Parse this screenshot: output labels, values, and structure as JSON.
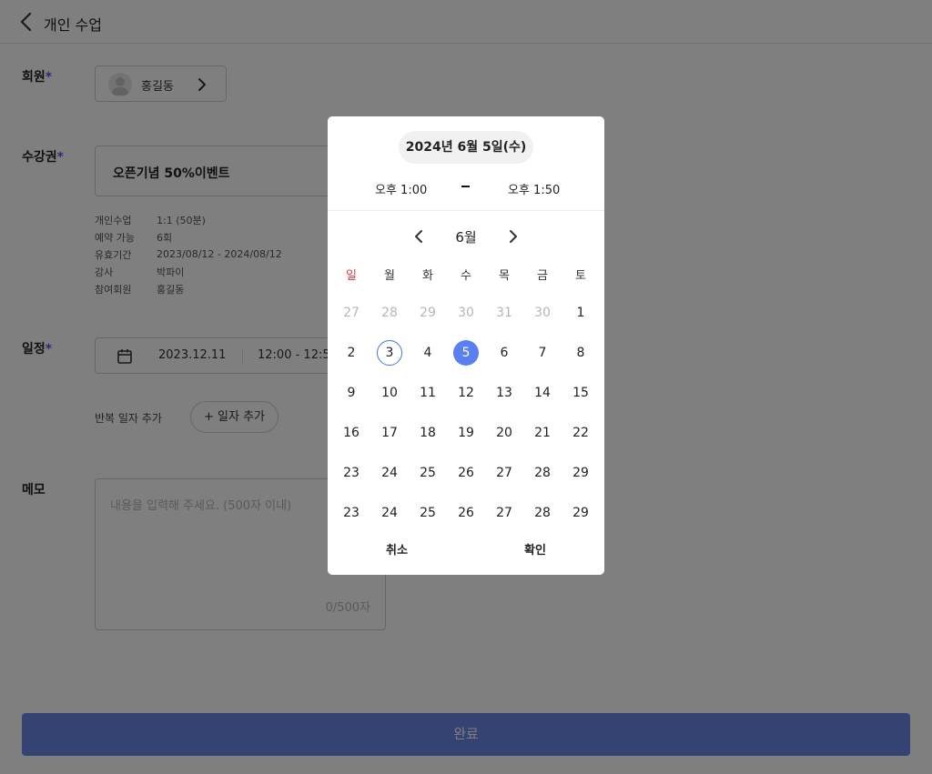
{
  "header": {
    "title": "개인 수업"
  },
  "member": {
    "label": "회원",
    "required_mark": "*",
    "name": "홍길동"
  },
  "pass": {
    "label": "수강권",
    "required_mark": "*",
    "name": "오픈기념 50%이벤트",
    "details": [
      {
        "key": "개인수업",
        "value": "1:1 (50분)"
      },
      {
        "key": "예약 가능",
        "value": "6회"
      },
      {
        "key": "유효기간",
        "value": "2023/08/12 - 2024/08/12"
      },
      {
        "key": "강사",
        "value": "박파이"
      },
      {
        "key": "참여회원",
        "value": "홍길동"
      }
    ]
  },
  "schedule": {
    "label": "일정",
    "required_mark": "*",
    "date": "2023.12.11",
    "time": "12:00 - 12:50",
    "repeat_label": "반복 일자 추가",
    "add_day_button": "+ 일자 추가"
  },
  "memo": {
    "label": "메모",
    "placeholder": "내용을 입력해 주세요. (500자 이내)",
    "counter": "0/500자"
  },
  "done_button": "완료",
  "picker": {
    "selected_date": "2024년  6월 5일(수)",
    "start_time": "오후 1:00",
    "end_time": "오후 1:50",
    "month": "6월",
    "weekdays": [
      "일",
      "월",
      "화",
      "수",
      "목",
      "금",
      "토"
    ],
    "weeks": [
      [
        "27",
        "28",
        "29",
        "30",
        "31",
        "30",
        "1"
      ],
      [
        "2",
        "3",
        "4",
        "5",
        "6",
        "7",
        "8"
      ],
      [
        "9",
        "10",
        "11",
        "12",
        "13",
        "14",
        "15"
      ],
      [
        "16",
        "17",
        "18",
        "19",
        "20",
        "21",
        "22"
      ],
      [
        "23",
        "24",
        "25",
        "26",
        "27",
        "28",
        "29"
      ],
      [
        "23",
        "24",
        "25",
        "26",
        "27",
        "28",
        "29"
      ]
    ],
    "muted_days_in_first_week": 6,
    "today": "3",
    "selected": "5",
    "cancel": "취소",
    "confirm": "확인"
  },
  "colors": {
    "accent": "#5a7ff0",
    "today_ring": "#4d76e3",
    "required": "#6a50e8",
    "sunday": "#e0393e",
    "overlay": "rgba(0,0,0,0.5)"
  }
}
